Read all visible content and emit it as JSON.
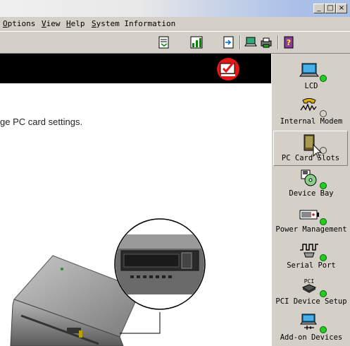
{
  "menu": {
    "options": "Options",
    "view": "View",
    "help": "Help",
    "system_information": "System Information"
  },
  "window_buttons": {
    "minimize": "_",
    "maximize": "□",
    "close": "×"
  },
  "content": {
    "description": "ge PC card settings."
  },
  "sidebar": {
    "items": [
      {
        "label": "LCD",
        "icon": "lcd-monitor-icon",
        "status": "green"
      },
      {
        "label": "Internal Modem",
        "icon": "phone-modem-icon",
        "status": "off"
      },
      {
        "label": "PC Card Slots",
        "icon": "pc-card-icon",
        "status": "off"
      },
      {
        "label": "Device Bay",
        "icon": "device-bay-icon",
        "status": "green"
      },
      {
        "label": "Power Management",
        "icon": "battery-icon",
        "status": "green"
      },
      {
        "label": "Serial Port",
        "icon": "serial-port-icon",
        "status": "green"
      },
      {
        "label": "PCI Device Setup",
        "icon": "pci-chip-icon",
        "status": "green"
      },
      {
        "label": "Add-on Devices",
        "icon": "usb-icon",
        "status": "green"
      }
    ],
    "pci_chip_text": "PCI"
  },
  "colors": {
    "status_green": "#22cc22",
    "header_badge": "#e01818",
    "black_header": "#000000"
  }
}
